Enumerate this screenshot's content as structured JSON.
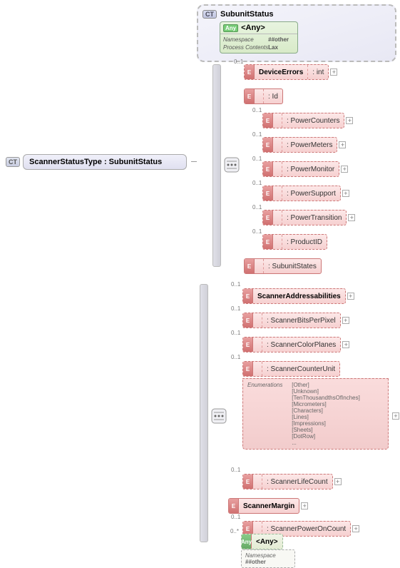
{
  "root": {
    "label": "ScannerStatusType : SubunitStatus",
    "badge": "CT"
  },
  "subunit": {
    "badge": "CT",
    "title": "SubunitStatus",
    "any": {
      "badge": "Any",
      "label": "<Any>",
      "ns_key": "Namespace",
      "ns_val": "##other",
      "pc_key": "Process Contents",
      "pc_val": "Lax"
    },
    "items": [
      {
        "occ": "0..1",
        "label": "DeviceErrors",
        "type": "int"
      },
      {
        "ref": true,
        "label": "<Ref>",
        "type": "Id"
      },
      {
        "occ": "0..1",
        "ref": true,
        "label": "<Ref>",
        "type": "PowerCounters"
      },
      {
        "occ": "0..1",
        "ref": true,
        "label": "<Ref>",
        "type": "PowerMeters"
      },
      {
        "occ": "0..1",
        "ref": true,
        "label": "<Ref>",
        "type": "PowerMonitor"
      },
      {
        "occ": "0..1",
        "ref": true,
        "label": "<Ref>",
        "type": "PowerSupport"
      },
      {
        "occ": "0..1",
        "ref": true,
        "label": "<Ref>",
        "type": "PowerTransition"
      },
      {
        "occ": "0..1",
        "ref": true,
        "label": "<Ref>",
        "type": "ProductID"
      },
      {
        "ref": true,
        "label": "<Ref>",
        "type": "SubunitStates"
      }
    ]
  },
  "scanner": {
    "items": [
      {
        "occ": "0..1",
        "label": "ScannerAddressabilities"
      },
      {
        "occ": "0..1",
        "ref": true,
        "label": "<Ref>",
        "type": "ScannerBitsPerPixel"
      },
      {
        "occ": "0..1",
        "ref": true,
        "label": "<Ref>",
        "type": "ScannerColorPlanes"
      },
      {
        "ref": true,
        "label": "<Ref>",
        "type": "ScannerCounterUnit"
      },
      {
        "occ": "0..1",
        "ref": true,
        "label": "<Ref>",
        "type": "ScannerLifeCount"
      },
      {
        "label": "ScannerMargin"
      },
      {
        "occ": "0..1",
        "ref": true,
        "label": "<Ref>",
        "type": "ScannerPowerOnCount"
      }
    ],
    "enums": {
      "key": "Enumerations",
      "vals": [
        "[Other]",
        "[Unknown]",
        "[TenThousandthsOfInches]",
        "[Micrometers]",
        "[Characters]",
        "[Lines]",
        "[Impressions]",
        "[Sheets]",
        "[DotRow]",
        "..."
      ]
    },
    "any": {
      "occ": "0..*",
      "badge": "Any",
      "label": "<Any>",
      "ns_key": "Namespace",
      "ns_val": "##other"
    }
  }
}
